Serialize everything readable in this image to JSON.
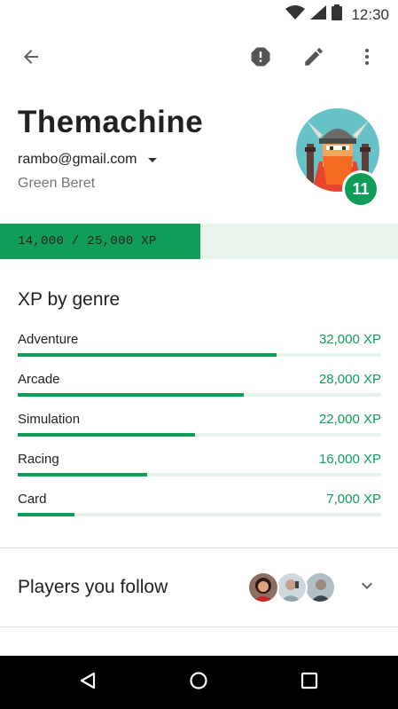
{
  "status_bar": {
    "time": "12:30",
    "icons": [
      "wifi-icon",
      "cellular-signal-icon",
      "battery-icon"
    ]
  },
  "toolbar": {
    "back_icon": "arrow-back-icon",
    "report_icon": "report-octagon-icon",
    "edit_icon": "pencil-icon",
    "more_icon": "more-vertical-icon"
  },
  "profile": {
    "gamer_name": "Themachine",
    "email": "rambo@gmail.com",
    "rank_title": "Green Beret",
    "level": "11",
    "avatar": "viking-avatar"
  },
  "xp_progress": {
    "label": "14,000 / 25,000 XP",
    "current": 14000,
    "max": 25000
  },
  "genres": {
    "title": "XP by genre",
    "max_xp": 45000,
    "items": [
      {
        "name": "Adventure",
        "xp_label": "32,000 XP",
        "xp": 32000
      },
      {
        "name": "Arcade",
        "xp_label": "28,000 XP",
        "xp": 28000
      },
      {
        "name": "Simulation",
        "xp_label": "22,000 XP",
        "xp": 22000
      },
      {
        "name": "Racing",
        "xp_label": "16,000 XP",
        "xp": 16000
      },
      {
        "name": "Card",
        "xp_label": "7,000 XP",
        "xp": 7000
      }
    ]
  },
  "players_follow": {
    "title": "Players you follow",
    "avatars": [
      "player-avatar-woman",
      "player-avatar-man-phone",
      "player-avatar-man-profile"
    ],
    "expand_icon": "chevron-down-icon"
  },
  "nav_bar": {
    "icons": [
      "nav-back-icon",
      "nav-home-icon",
      "nav-recents-icon"
    ]
  },
  "colors": {
    "accent": "#0f9d58",
    "accent_light": "#e6f4ec",
    "text_primary": "#212121",
    "text_secondary": "#757575",
    "nav_background": "#000000"
  }
}
